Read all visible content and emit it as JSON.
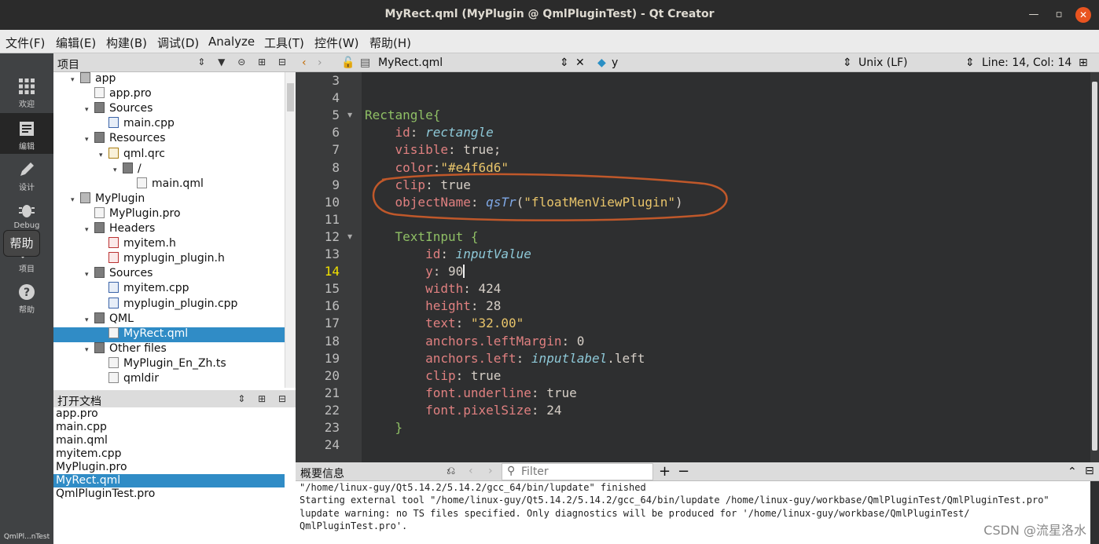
{
  "window": {
    "title": "MyRect.qml (MyPlugin @ QmlPluginTest) - Qt Creator"
  },
  "menu": [
    "文件(F)",
    "编辑(E)",
    "构建(B)",
    "调试(D)",
    "Analyze",
    "工具(T)",
    "控件(W)",
    "帮助(H)"
  ],
  "modes": [
    {
      "label": "欢迎",
      "icon": "welcome-grid-icon"
    },
    {
      "label": "编辑",
      "icon": "edit-document-icon"
    },
    {
      "label": "设计",
      "icon": "design-pen-icon"
    },
    {
      "label": "Debug",
      "icon": "debug-bug-icon"
    },
    {
      "label": "项目",
      "icon": "project-wrench-icon"
    },
    {
      "label": "帮助",
      "icon": "help-question-icon"
    }
  ],
  "tooltip": "帮助",
  "kit": "QmlPl...nTest",
  "project_panel": {
    "title": "项目",
    "tree": [
      {
        "label": "app",
        "depth": 1,
        "arrow": "▾",
        "icon": "proj"
      },
      {
        "label": "app.pro",
        "depth": 2,
        "arrow": "",
        "icon": "file"
      },
      {
        "label": "Sources",
        "depth": 2,
        "arrow": "▾",
        "icon": "folder"
      },
      {
        "label": "main.cpp",
        "depth": 3,
        "arrow": "",
        "icon": "cpp"
      },
      {
        "label": "Resources",
        "depth": 2,
        "arrow": "▾",
        "icon": "folder"
      },
      {
        "label": "qml.qrc",
        "depth": 3,
        "arrow": "▾",
        "icon": "qrc"
      },
      {
        "label": "/",
        "depth": 4,
        "arrow": "▾",
        "icon": "folder"
      },
      {
        "label": "main.qml",
        "depth": 5,
        "arrow": "",
        "icon": "file"
      },
      {
        "label": "MyPlugin",
        "depth": 1,
        "arrow": "▾",
        "icon": "proj"
      },
      {
        "label": "MyPlugin.pro",
        "depth": 2,
        "arrow": "",
        "icon": "file"
      },
      {
        "label": "Headers",
        "depth": 2,
        "arrow": "▾",
        "icon": "folder"
      },
      {
        "label": "myitem.h",
        "depth": 3,
        "arrow": "",
        "icon": "h"
      },
      {
        "label": "myplugin_plugin.h",
        "depth": 3,
        "arrow": "",
        "icon": "h"
      },
      {
        "label": "Sources",
        "depth": 2,
        "arrow": "▾",
        "icon": "folder"
      },
      {
        "label": "myitem.cpp",
        "depth": 3,
        "arrow": "",
        "icon": "cpp"
      },
      {
        "label": "myplugin_plugin.cpp",
        "depth": 3,
        "arrow": "",
        "icon": "cpp"
      },
      {
        "label": "QML",
        "depth": 2,
        "arrow": "▾",
        "icon": "folder"
      },
      {
        "label": "MyRect.qml",
        "depth": 3,
        "arrow": "",
        "icon": "file",
        "selected": true
      },
      {
        "label": "Other files",
        "depth": 2,
        "arrow": "▾",
        "icon": "folder"
      },
      {
        "label": "MyPlugin_En_Zh.ts",
        "depth": 3,
        "arrow": "",
        "icon": "file"
      },
      {
        "label": "qmldir",
        "depth": 3,
        "arrow": "",
        "icon": "file"
      }
    ]
  },
  "open_docs": {
    "title": "打开文档",
    "items": [
      "app.pro",
      "main.cpp",
      "main.qml",
      "myitem.cpp",
      "MyPlugin.pro",
      "MyRect.qml",
      "QmlPluginTest.pro"
    ],
    "selected_index": 5
  },
  "editor_toolbar": {
    "file": "MyRect.qml",
    "symbol": "y",
    "line_ending": "Unix (LF)",
    "position": "Line: 14, Col: 14"
  },
  "editor": {
    "current_line": 14,
    "lines": [
      {
        "n": 3,
        "tokens": []
      },
      {
        "n": 4,
        "tokens": []
      },
      {
        "n": 5,
        "fold": true,
        "tokens": [
          {
            "c": "k-type",
            "t": "Rectangle{"
          }
        ]
      },
      {
        "n": 6,
        "tokens": [
          {
            "c": "k-plain",
            "t": "    "
          },
          {
            "c": "k-prop",
            "t": "id"
          },
          {
            "c": "k-plain",
            "t": ": "
          },
          {
            "c": "k-id",
            "t": "rectangle"
          }
        ]
      },
      {
        "n": 7,
        "tokens": [
          {
            "c": "k-plain",
            "t": "    "
          },
          {
            "c": "k-prop",
            "t": "visible"
          },
          {
            "c": "k-plain",
            "t": ": true;"
          }
        ]
      },
      {
        "n": 8,
        "tokens": [
          {
            "c": "k-plain",
            "t": "    "
          },
          {
            "c": "k-prop",
            "t": "color"
          },
          {
            "c": "k-plain",
            "t": ":"
          },
          {
            "c": "k-str",
            "t": "\"#e4f6d6\""
          }
        ]
      },
      {
        "n": 9,
        "tokens": [
          {
            "c": "k-plain",
            "t": "    "
          },
          {
            "c": "k-prop",
            "t": "clip"
          },
          {
            "c": "k-plain",
            "t": ": true"
          }
        ]
      },
      {
        "n": 10,
        "tokens": [
          {
            "c": "k-plain",
            "t": "    "
          },
          {
            "c": "k-prop",
            "t": "objectName"
          },
          {
            "c": "k-plain",
            "t": ": "
          },
          {
            "c": "k-fn",
            "t": "qsTr"
          },
          {
            "c": "k-plain",
            "t": "("
          },
          {
            "c": "k-str",
            "t": "\"floatMenViewPlugin\""
          },
          {
            "c": "k-plain",
            "t": ")"
          }
        ]
      },
      {
        "n": 11,
        "tokens": []
      },
      {
        "n": 12,
        "fold": true,
        "tokens": [
          {
            "c": "k-plain",
            "t": "    "
          },
          {
            "c": "k-type",
            "t": "TextInput {"
          }
        ]
      },
      {
        "n": 13,
        "tokens": [
          {
            "c": "k-plain",
            "t": "        "
          },
          {
            "c": "k-prop",
            "t": "id"
          },
          {
            "c": "k-plain",
            "t": ": "
          },
          {
            "c": "k-id",
            "t": "inputValue"
          }
        ]
      },
      {
        "n": 14,
        "caret": true,
        "tokens": [
          {
            "c": "k-plain",
            "t": "        "
          },
          {
            "c": "k-prop",
            "t": "y"
          },
          {
            "c": "k-plain",
            "t": ": 90"
          }
        ]
      },
      {
        "n": 15,
        "tokens": [
          {
            "c": "k-plain",
            "t": "        "
          },
          {
            "c": "k-prop",
            "t": "width"
          },
          {
            "c": "k-plain",
            "t": ": 424"
          }
        ]
      },
      {
        "n": 16,
        "tokens": [
          {
            "c": "k-plain",
            "t": "        "
          },
          {
            "c": "k-prop",
            "t": "height"
          },
          {
            "c": "k-plain",
            "t": ": 28"
          }
        ]
      },
      {
        "n": 17,
        "tokens": [
          {
            "c": "k-plain",
            "t": "        "
          },
          {
            "c": "k-prop",
            "t": "text"
          },
          {
            "c": "k-plain",
            "t": ": "
          },
          {
            "c": "k-str",
            "t": "\"32.00\""
          }
        ]
      },
      {
        "n": 18,
        "tokens": [
          {
            "c": "k-plain",
            "t": "        "
          },
          {
            "c": "k-prop",
            "t": "anchors.leftMargin"
          },
          {
            "c": "k-plain",
            "t": ": 0"
          }
        ]
      },
      {
        "n": 19,
        "tokens": [
          {
            "c": "k-plain",
            "t": "        "
          },
          {
            "c": "k-prop",
            "t": "anchors.left"
          },
          {
            "c": "k-plain",
            "t": ": "
          },
          {
            "c": "k-id",
            "t": "inputlabel"
          },
          {
            "c": "k-plain",
            "t": ".left"
          }
        ]
      },
      {
        "n": 20,
        "tokens": [
          {
            "c": "k-plain",
            "t": "        "
          },
          {
            "c": "k-prop",
            "t": "clip"
          },
          {
            "c": "k-plain",
            "t": ": true"
          }
        ]
      },
      {
        "n": 21,
        "tokens": [
          {
            "c": "k-plain",
            "t": "        "
          },
          {
            "c": "k-prop",
            "t": "font.underline"
          },
          {
            "c": "k-plain",
            "t": ": true"
          }
        ]
      },
      {
        "n": 22,
        "tokens": [
          {
            "c": "k-plain",
            "t": "        "
          },
          {
            "c": "k-prop",
            "t": "font.pixelSize"
          },
          {
            "c": "k-plain",
            "t": ": 24"
          }
        ]
      },
      {
        "n": 23,
        "tokens": [
          {
            "c": "k-plain",
            "t": "    "
          },
          {
            "c": "k-type",
            "t": "}"
          }
        ]
      },
      {
        "n": 24,
        "tokens": []
      }
    ]
  },
  "output": {
    "title": "概要信息",
    "filter_placeholder": "Filter",
    "lines": [
      "\"/home/linux-guy/Qt5.14.2/5.14.2/gcc_64/bin/lupdate\" finished",
      "Starting external tool \"/home/linux-guy/Qt5.14.2/5.14.2/gcc_64/bin/lupdate /home/linux-guy/workbase/QmlPluginTest/QmlPluginTest.pro\"",
      "lupdate warning: no TS files specified. Only diagnostics will be produced for '/home/linux-guy/workbase/QmlPluginTest/",
      "QmlPluginTest.pro'."
    ]
  },
  "watermark": "CSDN @流星洛水",
  "colors": {
    "selection": "#308cc6",
    "annotation_circle": "#c0582a",
    "current_line_number": "#f0e000"
  }
}
